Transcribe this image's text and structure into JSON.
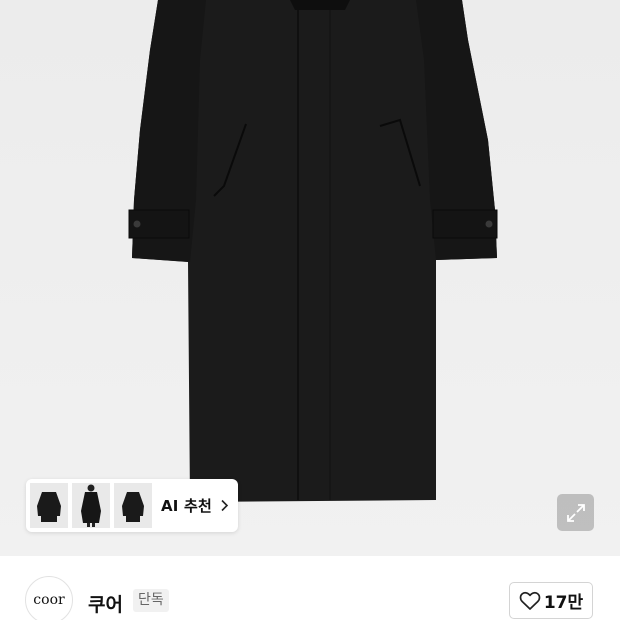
{
  "product_image": {
    "alt_icon": "coat-image"
  },
  "ai_recommend": {
    "label": "AI 추천",
    "thumbnails": [
      "coat-thumb-1",
      "coat-thumb-2",
      "coat-thumb-3"
    ]
  },
  "expand": {
    "icon": "expand-icon"
  },
  "brand": {
    "logo_text": "coor",
    "name": "쿠어",
    "badge": "단독"
  },
  "like": {
    "icon": "heart-icon",
    "count": "17만"
  }
}
